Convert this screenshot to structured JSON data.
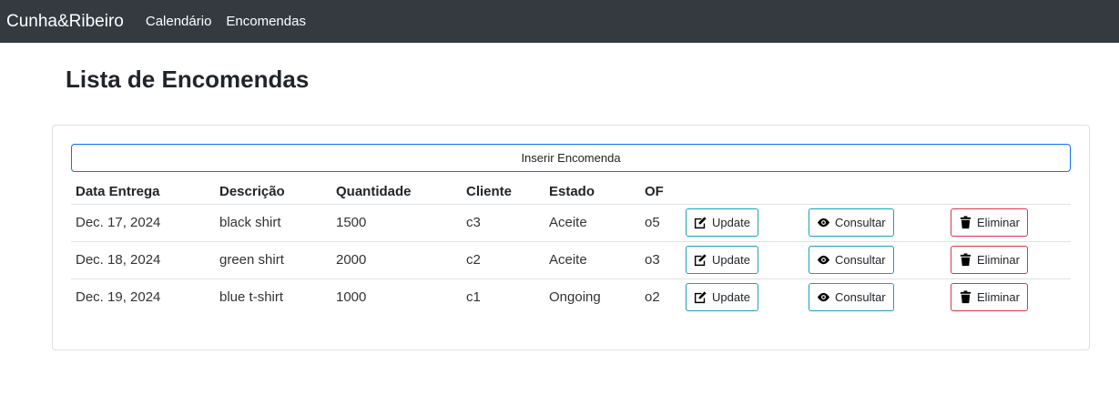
{
  "nav": {
    "brand": "Cunha&Ribeiro",
    "links": [
      "Calendário",
      "Encomendas"
    ]
  },
  "page": {
    "title": "Lista de Encomendas",
    "insert_button": "Inserir Encomenda"
  },
  "table": {
    "headers": [
      "Data Entrega",
      "Descrição",
      "Quantidade",
      "Cliente",
      "Estado",
      "OF"
    ],
    "rows": [
      {
        "date": "Dec. 17, 2024",
        "description": "black shirt",
        "quantity": "1500",
        "client": "c3",
        "state": "Aceite",
        "of": "o5"
      },
      {
        "date": "Dec. 18, 2024",
        "description": "green shirt",
        "quantity": "2000",
        "client": "c2",
        "state": "Aceite",
        "of": "o3"
      },
      {
        "date": "Dec. 19, 2024",
        "description": "blue t-shirt",
        "quantity": "1000",
        "client": "c1",
        "state": "Ongoing",
        "of": "o2"
      }
    ],
    "actions": {
      "update": "Update",
      "consult": "Consultar",
      "delete": "Eliminar"
    }
  },
  "colors": {
    "navbar": "#343a40",
    "primary": "#0d6efd",
    "info": "#17a2b8",
    "danger": "#dc3545"
  },
  "icons": {
    "update": "edit-icon",
    "consult": "eye-icon",
    "delete": "trash-icon"
  }
}
